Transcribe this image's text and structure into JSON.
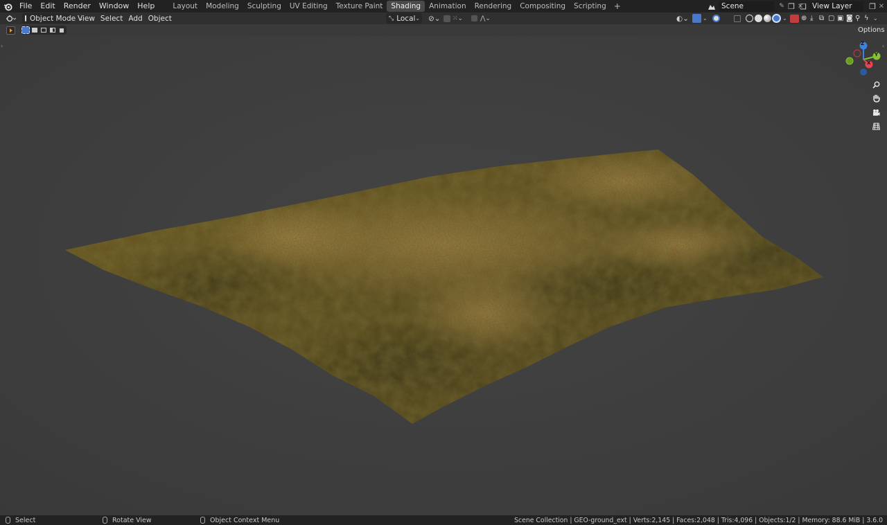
{
  "topbar": {
    "menus": [
      "File",
      "Edit",
      "Render",
      "Window",
      "Help"
    ],
    "workspaces": [
      "Layout",
      "Modeling",
      "Sculpting",
      "UV Editing",
      "Texture Paint",
      "Shading",
      "Animation",
      "Rendering",
      "Compositing",
      "Scripting"
    ],
    "active_workspace": "Shading",
    "add_tab": "+",
    "scene_name": "Scene",
    "view_layer": "View Layer"
  },
  "header": {
    "mode": "Object Mode",
    "menus": [
      "View",
      "Select",
      "Add",
      "Object"
    ],
    "orientation": "Local"
  },
  "toolrow": {
    "options": "Options"
  },
  "gizmo": {
    "z": "Z",
    "y": "Y",
    "x": "X"
  },
  "statusbar": {
    "select": "Select",
    "rotate": "Rotate View",
    "context": "Object Context Menu",
    "info": "Scene Collection | GEO-ground_ext | Verts:2,145 | Faces:2,048 | Tris:4,096 | Objects:1/2 | Memory: 88.6 MiB | 3.6.0"
  },
  "colors": {
    "active_tab": "#4a4a4a",
    "axis_x": "#e8434f",
    "axis_y": "#82c42e",
    "axis_z": "#3a83e5",
    "selection_blue": "#4a78c8"
  },
  "icons": [
    "blender-logo-icon",
    "editor-type-icon",
    "object-mode-icon",
    "orientation-icon",
    "pivot-icon",
    "snap-icon",
    "proportional-edit-icon",
    "visibility-icon",
    "gizmo-icon",
    "overlay-icon",
    "xray-icon",
    "wireframe-shading-icon",
    "solid-shading-icon",
    "material-shading-icon",
    "rendered-shading-icon",
    "zoom-icon",
    "pan-hand-icon",
    "camera-icon",
    "grid-icon"
  ]
}
